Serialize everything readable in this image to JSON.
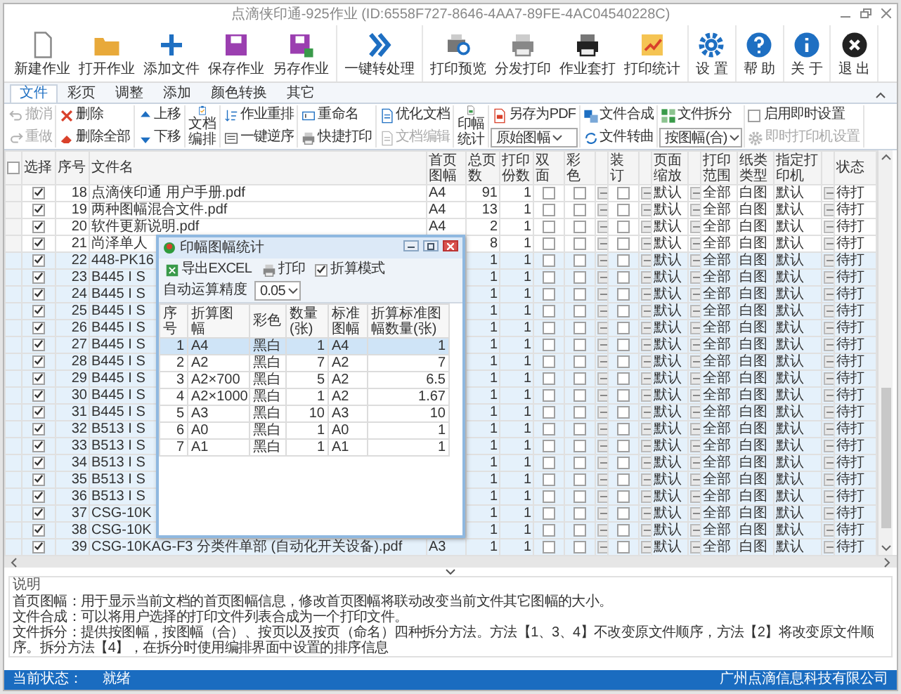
{
  "window": {
    "title": "点滴侠印通-925作业 (ID:6558F727-8646-4AA7-89FE-4AC04540228C)"
  },
  "toolbar": [
    [
      {
        "label": "新建作业"
      },
      {
        "label": "打开作业"
      },
      {
        "label": "添加文件"
      },
      {
        "label": "保存作业"
      },
      {
        "label": "另存作业"
      }
    ],
    [
      {
        "label": "一键转处理"
      }
    ],
    [
      {
        "label": "打印预览"
      },
      {
        "label": "分发打印"
      },
      {
        "label": "作业套打"
      },
      {
        "label": "打印统计"
      }
    ],
    [
      {
        "label": "设 置"
      }
    ],
    [
      {
        "label": "帮 助"
      }
    ],
    [
      {
        "label": "关 于"
      }
    ],
    [
      {
        "label": "退 出"
      }
    ]
  ],
  "ribbon": {
    "tabs": [
      {
        "label": "文件",
        "selected": true
      },
      {
        "label": "彩页",
        "selected": false
      },
      {
        "label": "调整",
        "selected": false
      },
      {
        "label": "添加",
        "selected": false
      },
      {
        "label": "颜色转换",
        "selected": false
      },
      {
        "label": "其它",
        "selected": false
      }
    ],
    "groups": [
      [
        {
          "kind": "button",
          "label": "撤消",
          "disabled": true
        },
        {
          "kind": "button",
          "label": "重做",
          "disabled": true
        }
      ],
      [
        {
          "kind": "button",
          "label": "删除",
          "disabled": false
        },
        {
          "kind": "button",
          "label": "删除全部",
          "disabled": false
        }
      ],
      [
        {
          "kind": "button",
          "label": "上移",
          "disabled": false
        },
        {
          "kind": "button",
          "label": "下移",
          "disabled": false
        }
      ],
      [
        {
          "kind": "large",
          "label": "文档编排",
          "disabled": false
        }
      ],
      [
        {
          "kind": "button",
          "label": "作业重排",
          "disabled": false
        },
        {
          "kind": "button",
          "label": "一键逆序",
          "disabled": false
        }
      ],
      [
        {
          "kind": "button",
          "label": "重命名",
          "disabled": false
        },
        {
          "kind": "button",
          "label": "快捷打印",
          "disabled": false
        }
      ],
      [
        {
          "kind": "button",
          "label": "优化文档",
          "disabled": false
        },
        {
          "kind": "button",
          "label": "文档编辑",
          "disabled": true
        }
      ],
      [
        {
          "kind": "large",
          "label": "印幅统计",
          "disabled": false
        }
      ],
      [
        {
          "kind": "button",
          "label": "另存为PDF",
          "disabled": false
        },
        {
          "kind": "select",
          "value": "原始图幅"
        }
      ],
      [
        {
          "kind": "button",
          "label": "文件合成",
          "disabled": false
        },
        {
          "kind": "button",
          "label": "文件转曲",
          "disabled": false
        }
      ],
      [
        {
          "kind": "button",
          "label": "文件拆分",
          "disabled": false
        },
        {
          "kind": "select",
          "value": "按图幅(合)"
        }
      ],
      [
        {
          "kind": "checkbox",
          "label": "启用即时设置",
          "checked": false
        },
        {
          "kind": "button",
          "label": "即时打印机设置",
          "disabled": true
        }
      ]
    ]
  },
  "table": {
    "columns": [
      {
        "kind": "select_all",
        "checked": false
      },
      {
        "kind": "text",
        "label": "选择"
      },
      {
        "kind": "text",
        "label": "序号"
      },
      {
        "kind": "text",
        "label": "文件名"
      },
      {
        "kind": "text",
        "label": "首页图幅"
      },
      {
        "kind": "text",
        "label": "总页数"
      },
      {
        "kind": "text",
        "label": "打印份数"
      },
      {
        "kind": "text",
        "label": "双面"
      },
      {
        "kind": "text",
        "label": "彩色"
      },
      {
        "kind": "button"
      },
      {
        "kind": "text",
        "label": "装订"
      },
      {
        "kind": "button"
      },
      {
        "kind": "text",
        "label": "页面缩放"
      },
      {
        "kind": "button"
      },
      {
        "kind": "text",
        "label": "打印范围"
      },
      {
        "kind": "text",
        "label": "纸类类型"
      },
      {
        "kind": "text",
        "label": "指定打印机"
      },
      {
        "kind": "button"
      },
      {
        "kind": "text",
        "label": "状态"
      }
    ],
    "rows": [
      {
        "selected": false,
        "checked": true,
        "no": "18",
        "file": "点滴侠印通 用户手册.pdf",
        "first_size": "A4",
        "pages": "91",
        "copies": "1",
        "duplex": false,
        "color": false,
        "binding": false,
        "scale": "默认",
        "range": "全部",
        "paper": "白图",
        "printer": "默认",
        "status": "待打"
      },
      {
        "selected": false,
        "checked": true,
        "no": "19",
        "file": "两种图幅混合文件.pdf",
        "first_size": "A4",
        "pages": "13",
        "copies": "1",
        "duplex": false,
        "color": false,
        "binding": false,
        "scale": "默认",
        "range": "全部",
        "paper": "白图",
        "printer": "默认",
        "status": "待打"
      },
      {
        "selected": false,
        "checked": true,
        "no": "20",
        "file": "软件更新说明.pdf",
        "first_size": "A4",
        "pages": "2",
        "copies": "1",
        "duplex": false,
        "color": false,
        "binding": false,
        "scale": "默认",
        "range": "全部",
        "paper": "白图",
        "printer": "默认",
        "status": "待打"
      },
      {
        "selected": false,
        "checked": true,
        "no": "21",
        "file": "尚泽单人",
        "pages": "8",
        "copies": "1",
        "duplex": false,
        "color": false,
        "binding": false,
        "scale": "默认",
        "range": "全部",
        "paper": "白图",
        "printer": "默认",
        "status": "待打"
      },
      {
        "selected": true,
        "checked": true,
        "no": "22",
        "file": "448-PK16",
        "pages": "1",
        "copies": "1",
        "duplex": false,
        "color": false,
        "binding": false,
        "scale": "默认",
        "range": "全部",
        "paper": "白图",
        "printer": "默认",
        "status": "待打"
      },
      {
        "selected": true,
        "checked": true,
        "no": "23",
        "file": "B445 I S",
        "pages": "1",
        "copies": "1",
        "duplex": false,
        "color": false,
        "binding": false,
        "scale": "默认",
        "range": "全部",
        "paper": "白图",
        "printer": "默认",
        "status": "待打"
      },
      {
        "selected": true,
        "checked": true,
        "no": "24",
        "file": "B445 I S",
        "pages": "1",
        "copies": "1",
        "duplex": false,
        "color": false,
        "binding": false,
        "scale": "默认",
        "range": "全部",
        "paper": "白图",
        "printer": "默认",
        "status": "待打"
      },
      {
        "selected": true,
        "checked": true,
        "no": "25",
        "file": "B445 I S",
        "pages": "1",
        "copies": "1",
        "duplex": false,
        "color": false,
        "binding": false,
        "scale": "默认",
        "range": "全部",
        "paper": "白图",
        "printer": "默认",
        "status": "待打"
      },
      {
        "selected": true,
        "checked": true,
        "no": "26",
        "file": "B445 I S",
        "pages": "1",
        "copies": "1",
        "duplex": false,
        "color": false,
        "binding": false,
        "scale": "默认",
        "range": "全部",
        "paper": "白图",
        "printer": "默认",
        "status": "待打"
      },
      {
        "selected": true,
        "checked": true,
        "no": "27",
        "file": "B445 I S",
        "pages": "1",
        "copies": "1",
        "duplex": false,
        "color": false,
        "binding": false,
        "scale": "默认",
        "range": "全部",
        "paper": "白图",
        "printer": "默认",
        "status": "待打"
      },
      {
        "selected": true,
        "checked": true,
        "no": "28",
        "file": "B445 I S",
        "pages": "1",
        "copies": "1",
        "duplex": false,
        "color": false,
        "binding": false,
        "scale": "默认",
        "range": "全部",
        "paper": "白图",
        "printer": "默认",
        "status": "待打"
      },
      {
        "selected": true,
        "checked": true,
        "no": "29",
        "file": "B445 I S",
        "pages": "1",
        "copies": "1",
        "duplex": false,
        "color": false,
        "binding": false,
        "scale": "默认",
        "range": "全部",
        "paper": "白图",
        "printer": "默认",
        "status": "待打"
      },
      {
        "selected": true,
        "checked": true,
        "no": "30",
        "file": "B445 I S",
        "pages": "1",
        "copies": "1",
        "duplex": false,
        "color": false,
        "binding": false,
        "scale": "默认",
        "range": "全部",
        "paper": "白图",
        "printer": "默认",
        "status": "待打"
      },
      {
        "selected": true,
        "checked": true,
        "no": "31",
        "file": "B445 I S",
        "pages": "1",
        "copies": "1",
        "duplex": false,
        "color": false,
        "binding": false,
        "scale": "默认",
        "range": "全部",
        "paper": "白图",
        "printer": "默认",
        "status": "待打"
      },
      {
        "selected": true,
        "checked": true,
        "no": "32",
        "file": "B513 I S",
        "pages": "1",
        "copies": "1",
        "duplex": false,
        "color": false,
        "binding": false,
        "scale": "默认",
        "range": "全部",
        "paper": "白图",
        "printer": "默认",
        "status": "待打"
      },
      {
        "selected": true,
        "checked": true,
        "no": "33",
        "file": "B513 I S",
        "pages": "1",
        "copies": "1",
        "duplex": false,
        "color": false,
        "binding": false,
        "scale": "默认",
        "range": "全部",
        "paper": "白图",
        "printer": "默认",
        "status": "待打"
      },
      {
        "selected": true,
        "checked": true,
        "no": "34",
        "file": "B513 I S",
        "pages": "1",
        "copies": "1",
        "duplex": false,
        "color": false,
        "binding": false,
        "scale": "默认",
        "range": "全部",
        "paper": "白图",
        "printer": "默认",
        "status": "待打"
      },
      {
        "selected": true,
        "checked": true,
        "no": "35",
        "file": "B513 I S",
        "pages": "1",
        "copies": "1",
        "duplex": false,
        "color": false,
        "binding": false,
        "scale": "默认",
        "range": "全部",
        "paper": "白图",
        "printer": "默认",
        "status": "待打"
      },
      {
        "selected": true,
        "checked": true,
        "no": "36",
        "file": "B513 I S",
        "pages": "1",
        "copies": "1",
        "duplex": false,
        "color": false,
        "binding": false,
        "scale": "默认",
        "range": "全部",
        "paper": "白图",
        "printer": "默认",
        "status": "待打"
      },
      {
        "selected": true,
        "checked": true,
        "no": "37",
        "file": "CSG-10K",
        "pages": "1",
        "copies": "1",
        "duplex": false,
        "color": false,
        "binding": false,
        "scale": "默认",
        "range": "全部",
        "paper": "白图",
        "printer": "默认",
        "status": "待打"
      },
      {
        "selected": true,
        "checked": true,
        "no": "38",
        "file": "CSG-10K",
        "pages": "1",
        "copies": "1",
        "duplex": false,
        "color": false,
        "binding": false,
        "scale": "默认",
        "range": "全部",
        "paper": "白图",
        "printer": "默认",
        "status": "待打"
      },
      {
        "selected": true,
        "checked": true,
        "no": "39",
        "file": "CSG-10KAG-F3 分类件单部 (自动化开关设备).pdf",
        "first_size": "A3",
        "pages": "1",
        "copies": "1",
        "duplex": false,
        "color": false,
        "binding": false,
        "scale": "默认",
        "range": "全部",
        "paper": "白图",
        "printer": "默认",
        "status": "待打"
      }
    ]
  },
  "dialog": {
    "title": "印幅图幅统计",
    "toolbar": [
      {
        "kind": "button",
        "label": "导出EXCEL"
      },
      {
        "kind": "button",
        "label": "打印"
      },
      {
        "kind": "checkbox",
        "label": "折算模式",
        "checked": true
      },
      {
        "kind": "label",
        "label": "自动运算精度"
      },
      {
        "kind": "select",
        "value": "0.05"
      }
    ],
    "columns": [
      "序号",
      "折算图幅",
      "彩色",
      "数量(张)",
      "标准图幅",
      "折算标准图幅数量(张)"
    ],
    "rows": [
      {
        "selected": true,
        "cells": [
          "1",
          "A4",
          "黑白",
          "1",
          "A4",
          "1"
        ]
      },
      {
        "selected": false,
        "cells": [
          "2",
          "A2",
          "黑白",
          "7",
          "A2",
          "7"
        ]
      },
      {
        "selected": false,
        "cells": [
          "3",
          "A2×700",
          "黑白",
          "5",
          "A2",
          "6.5"
        ]
      },
      {
        "selected": false,
        "cells": [
          "4",
          "A2×1000",
          "黑白",
          "1",
          "A2",
          "1.67"
        ]
      },
      {
        "selected": false,
        "cells": [
          "5",
          "A3",
          "黑白",
          "10",
          "A3",
          "10"
        ]
      },
      {
        "selected": false,
        "cells": [
          "6",
          "A0",
          "黑白",
          "1",
          "A0",
          "1"
        ]
      },
      {
        "selected": false,
        "cells": [
          "7",
          "A1",
          "黑白",
          "1",
          "A1",
          "1"
        ]
      }
    ]
  },
  "notes": {
    "title": "说明",
    "lines": [
      "首页图幅：用于显示当前文档的首页图幅信息，修改首页图幅将联动改变当前文件其它图幅的大小。",
      "文件合成：可以将用户选择的打印文件列表合成为一个打印文件。",
      "文件拆分：提供按图幅，按图幅（合）、按页以及按页（命名）四种拆分方法。方法【1、3、4】不改变原文件顺序，方法【2】将改变原文件顺序。拆分方法【4】，在拆分时使用编排界面中设置的排序信息"
    ]
  },
  "status_bar": {
    "label": "当前状态：",
    "value": "就绪",
    "company": "广州点滴信息科技有限公司"
  }
}
